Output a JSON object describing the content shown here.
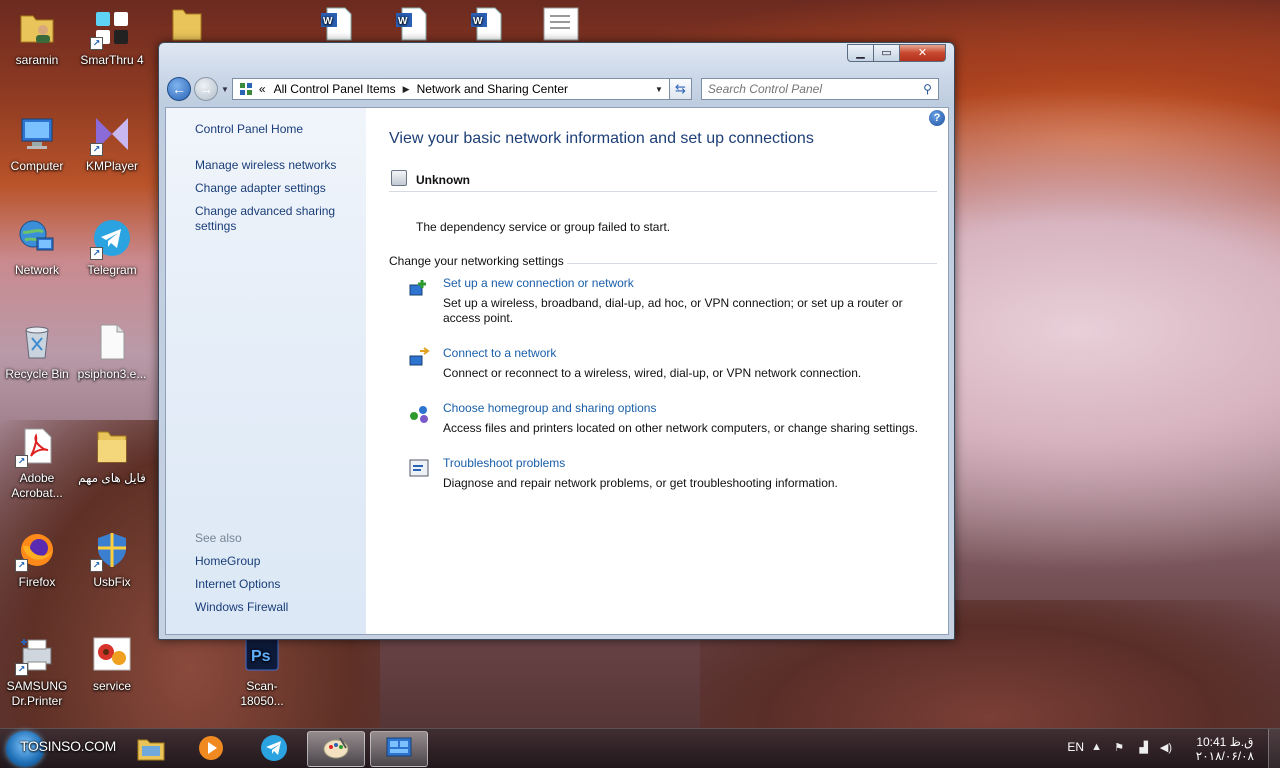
{
  "desktop": {
    "icons": [
      {
        "label": "saramin"
      },
      {
        "label": "SmarThru 4"
      },
      {
        "label": "Computer"
      },
      {
        "label": "KMPlayer"
      },
      {
        "label": "Network"
      },
      {
        "label": "Telegram"
      },
      {
        "label": "Recycle Bin"
      },
      {
        "label": "psiphon3.e..."
      },
      {
        "label": "Adobe Acrobat..."
      },
      {
        "label": "فایل های مهم"
      },
      {
        "label": "Firefox"
      },
      {
        "label": "UsbFix"
      },
      {
        "label": "SAMSUNG Dr.Printer"
      },
      {
        "label": "service"
      },
      {
        "label": "Scan-18050..."
      }
    ]
  },
  "window": {
    "controls": {
      "minimize": "▁",
      "maximize": "▭",
      "close": "✕"
    },
    "address": {
      "prefix": "«",
      "crumbs": [
        "All Control Panel Items",
        "Network and Sharing Center"
      ]
    },
    "search_placeholder": "Search Control Panel",
    "left_pane": {
      "home": "Control Panel Home",
      "links": [
        "Manage wireless networks",
        "Change adapter settings",
        "Change advanced sharing settings"
      ],
      "see_also_heading": "See also",
      "see_also": [
        "HomeGroup",
        "Internet Options",
        "Windows Firewall"
      ]
    },
    "main": {
      "title": "View your basic network information and set up connections",
      "network_name": "Unknown",
      "status_message": "The dependency service or group failed to start.",
      "section_heading": "Change your networking settings",
      "tasks": [
        {
          "link": "Set up a new connection or network",
          "desc": "Set up a wireless, broadband, dial-up, ad hoc, or VPN connection; or set up a router or access point.",
          "icon": "new-connection-icon"
        },
        {
          "link": "Connect to a network",
          "desc": "Connect or reconnect to a wireless, wired, dial-up, or VPN network connection.",
          "icon": "connect-network-icon"
        },
        {
          "link": "Choose homegroup and sharing options",
          "desc": "Access files and printers located on other network computers, or change sharing settings.",
          "icon": "homegroup-icon"
        },
        {
          "link": "Troubleshoot problems",
          "desc": "Diagnose and repair network problems, or get troubleshooting information.",
          "icon": "troubleshoot-icon"
        }
      ]
    }
  },
  "taskbar": {
    "start_watermark": "TOSINSO.COM",
    "language": "EN",
    "time": "10:41 ق.ظ",
    "date": "۲۰۱۸/۰۶/۰۸"
  },
  "colors": {
    "link": "#1a5fa8",
    "title": "#1e3f77"
  }
}
